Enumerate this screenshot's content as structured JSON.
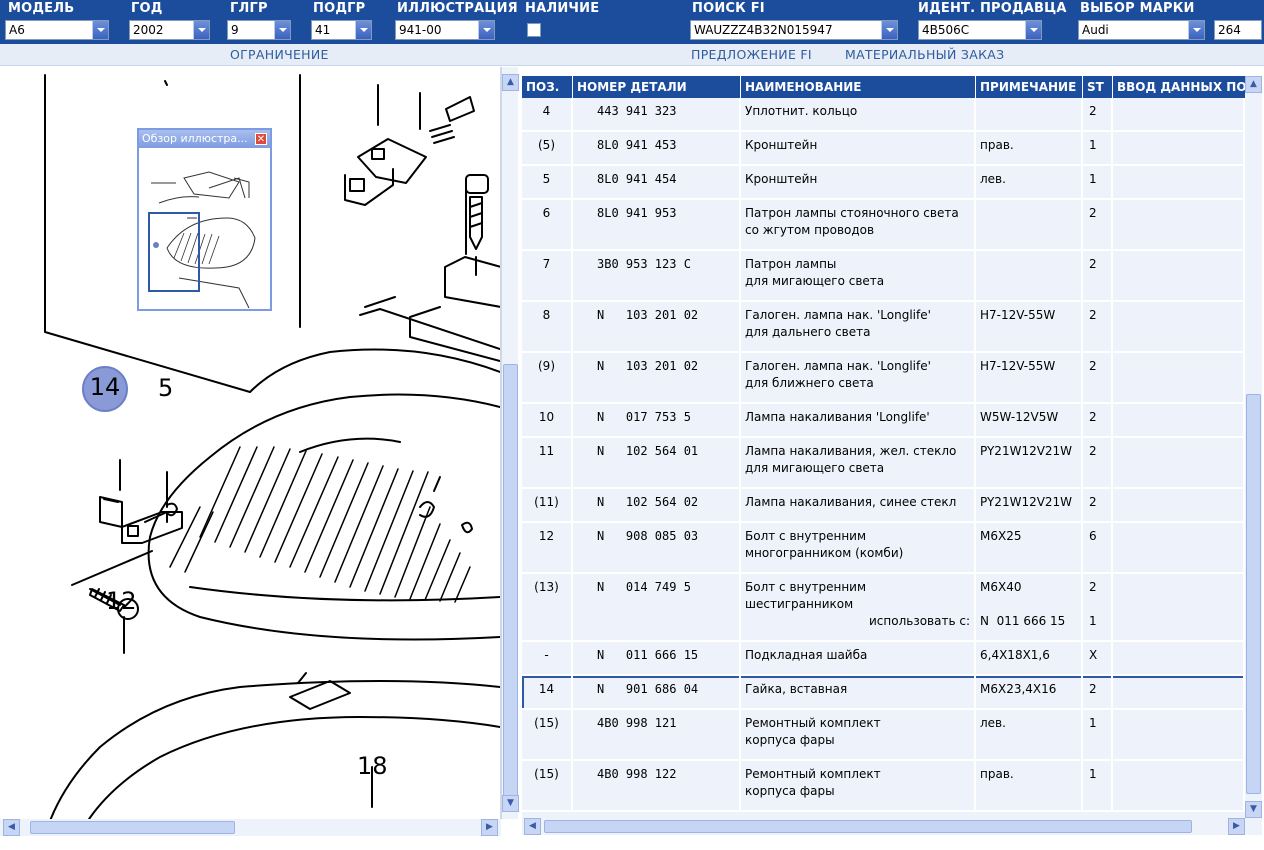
{
  "header": {
    "fields": [
      {
        "label": "МОДЕЛЬ",
        "value": "A6"
      },
      {
        "label": "ГОД",
        "value": "2002"
      },
      {
        "label": "ГЛГР",
        "value": "9"
      },
      {
        "label": "ПОДГР",
        "value": "41"
      },
      {
        "label": "ИЛЛЮСТРАЦИЯ",
        "value": "941-00"
      },
      {
        "label": "НАЛИЧИЕ",
        "value": ""
      },
      {
        "label": "ПОИСК FI",
        "value": "WAUZZZ4B32N015947"
      },
      {
        "label": "ИДЕНТ. ПРОДАВЦА",
        "value": "4B506C"
      },
      {
        "label": "ВЫБОР МАРКИ",
        "value": "Audi"
      }
    ],
    "extra_value": "264"
  },
  "subnav": {
    "restriction": "ОГРАНИЧЕНИЕ",
    "fi_offer": "ПРЕДЛОЖЕНИЕ FI",
    "material_order": "МАТЕРИАЛЬНЫЙ ЗАКАЗ"
  },
  "overview": {
    "title": "Обзор иллюстра..."
  },
  "illustration": {
    "callouts": [
      "14",
      "5",
      "12",
      "18"
    ]
  },
  "table": {
    "columns": [
      "ПОЗ.",
      "НОМЕР ДЕТАЛИ",
      "НАИМЕНОВАНИЕ",
      "ПРИМЕЧАНИЕ",
      "ST",
      "ВВОД ДАННЫХ ПО"
    ],
    "rows": [
      {
        "pos": "4",
        "part": "443 941 323",
        "name": "Уплотнит. кольцо",
        "note": "",
        "st": "2",
        "entry": ""
      },
      {
        "pos": "(5)",
        "part": "8L0 941 453",
        "name": "Кронштейн",
        "note": "прав.",
        "st": "1",
        "entry": ""
      },
      {
        "pos": "5",
        "part": "8L0 941 454",
        "name": "Кронштейн",
        "note": "лев.",
        "st": "1",
        "entry": ""
      },
      {
        "pos": "6",
        "part": "8L0 941 953",
        "name": "Патрон лампы стояночного света\nсо жгутом проводов",
        "note": "",
        "st": "2",
        "entry": ""
      },
      {
        "pos": "7",
        "part": "3B0 953 123 C",
        "name": "Патрон лампы\nдля мигающего света",
        "note": "",
        "st": "2",
        "entry": ""
      },
      {
        "pos": "8",
        "part": "N   103 201 02",
        "name": "Галоген. лампа нак. 'Longlife'\nдля дальнего света",
        "note": "H7-12V-55W",
        "st": "2",
        "entry": ""
      },
      {
        "pos": "(9)",
        "part": "N   103 201 02",
        "name": "Галоген. лампа нак. 'Longlife'\nдля ближнего света",
        "note": "H7-12V-55W",
        "st": "2",
        "entry": ""
      },
      {
        "pos": "10",
        "part": "N   017 753 5",
        "name": "Лампа накаливания 'Longlife'",
        "note": "W5W-12V5W",
        "st": "2",
        "entry": ""
      },
      {
        "pos": "11",
        "part": "N   102 564 01",
        "name": "Лампа накаливания, жел. стекло\nдля мигающего света",
        "note": "PY21W12V21W",
        "st": "2",
        "entry": ""
      },
      {
        "pos": "(11)",
        "part": "N   102 564 02",
        "name": "Лампа накаливания, синее стекл",
        "note": "PY21W12V21W",
        "st": "2",
        "entry": ""
      },
      {
        "pos": "12",
        "part": "N   908 085 03",
        "name": "Болт с внутренним\nмногогранником (комби)",
        "note": "M6X25",
        "st": "6",
        "entry": ""
      },
      {
        "pos": "(13)",
        "part": "N   014 749 5",
        "name": "Болт с внутренним\nшестигранником",
        "note": "M6X40",
        "st": "2",
        "entry": "",
        "sub_label": "использовать с:",
        "sub_note": "N  011 666 15",
        "sub_st": "1"
      },
      {
        "pos": "-",
        "part": "N   011 666 15",
        "name": "Подкладная шайба",
        "note": "6,4X18X1,6",
        "st": "X",
        "entry": ""
      },
      {
        "pos": "14",
        "part": "N   901 686 04",
        "name": "Гайка, вставная",
        "note": "M6X23,4X16",
        "st": "2",
        "entry": ""
      },
      {
        "pos": "(15)",
        "part": "4B0 998 121",
        "name": "Ремонтный комплект\nкорпуса фары",
        "note": "лев.",
        "st": "1",
        "entry": ""
      },
      {
        "pos": "(15)",
        "part": "4B0 998 122",
        "name": "Ремонтный комплект\nкорпуса фары",
        "note": "прав.",
        "st": "1",
        "entry": ""
      }
    ],
    "selected_index": 13
  },
  "colors": {
    "header_bg": "#1c4d9c",
    "row_bg": "#eef3fb",
    "selected_border": "#2e58a8",
    "callout_highlight": "#8a9ad6"
  }
}
